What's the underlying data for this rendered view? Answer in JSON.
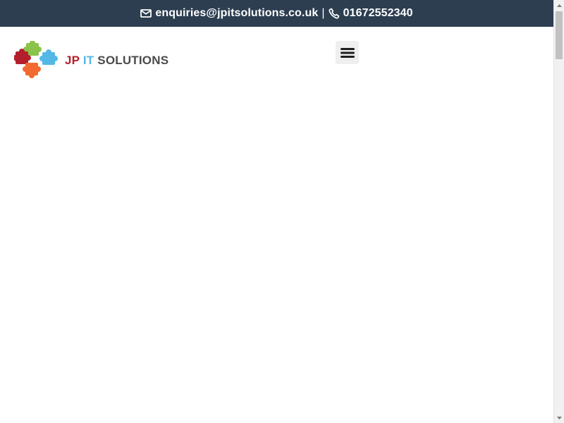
{
  "topbar": {
    "email": "enquiries@jpitsolutions.co.uk",
    "separator": "|",
    "phone": "01672552340",
    "background_color": "#2c3e50",
    "text_color": "#ffffff",
    "email_icon": "envelope-icon",
    "phone_icon": "phone-icon"
  },
  "logo": {
    "part1": "JP",
    "part2": "IT",
    "part3": "SOLUTIONS",
    "icon": "puzzle-pieces-icon",
    "colors": {
      "red": "#b41f2c",
      "green": "#8bc34a",
      "blue": "#54b8e6",
      "orange": "#f26a2e",
      "text": "#4a4a4a"
    }
  },
  "header": {
    "menu_icon": "hamburger-menu-icon"
  }
}
